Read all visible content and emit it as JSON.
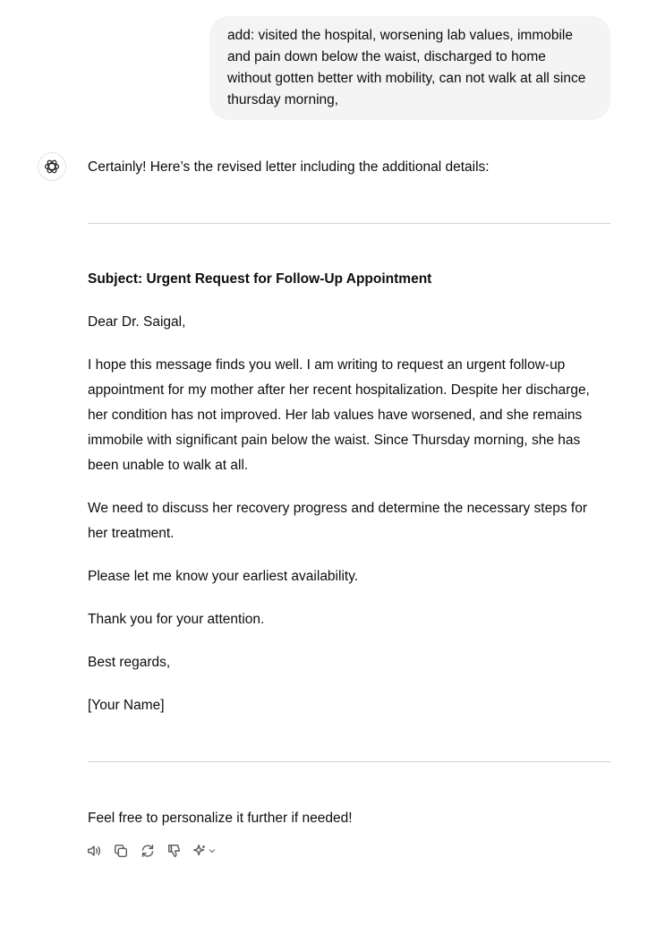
{
  "user_message": {
    "text": "add: visited the hospital, worsening lab values, immobile and pain down below the waist, discharged to home without gotten better with mobility, can not walk at all since thursday morning,"
  },
  "assistant": {
    "avatar_icon": "openai-logo-icon",
    "intro": "Certainly! Here’s the revised letter including the additional details:",
    "letter": {
      "subject": "Subject: Urgent Request for Follow-Up Appointment",
      "greeting": "Dear Dr. Saigal,",
      "paragraphs": [
        "I hope this message finds you well. I am writing to request an urgent follow-up appointment for my mother after her recent hospitalization. Despite her discharge, her condition has not improved. Her lab values have worsened, and she remains immobile with significant pain below the waist. Since Thursday morning, she has been unable to walk at all.",
        "We need to discuss her recovery progress and determine the necessary steps for her treatment.",
        "Please let me know your earliest availability.",
        "Thank you for your attention."
      ],
      "closing": "Best regards,",
      "signature": "[Your Name]"
    },
    "outro": "Feel free to personalize it further if needed!",
    "actions": [
      "read-aloud-icon",
      "copy-icon",
      "regenerate-icon",
      "thumbs-down-icon",
      "sparkle-icon",
      "chevron-down-icon"
    ]
  }
}
